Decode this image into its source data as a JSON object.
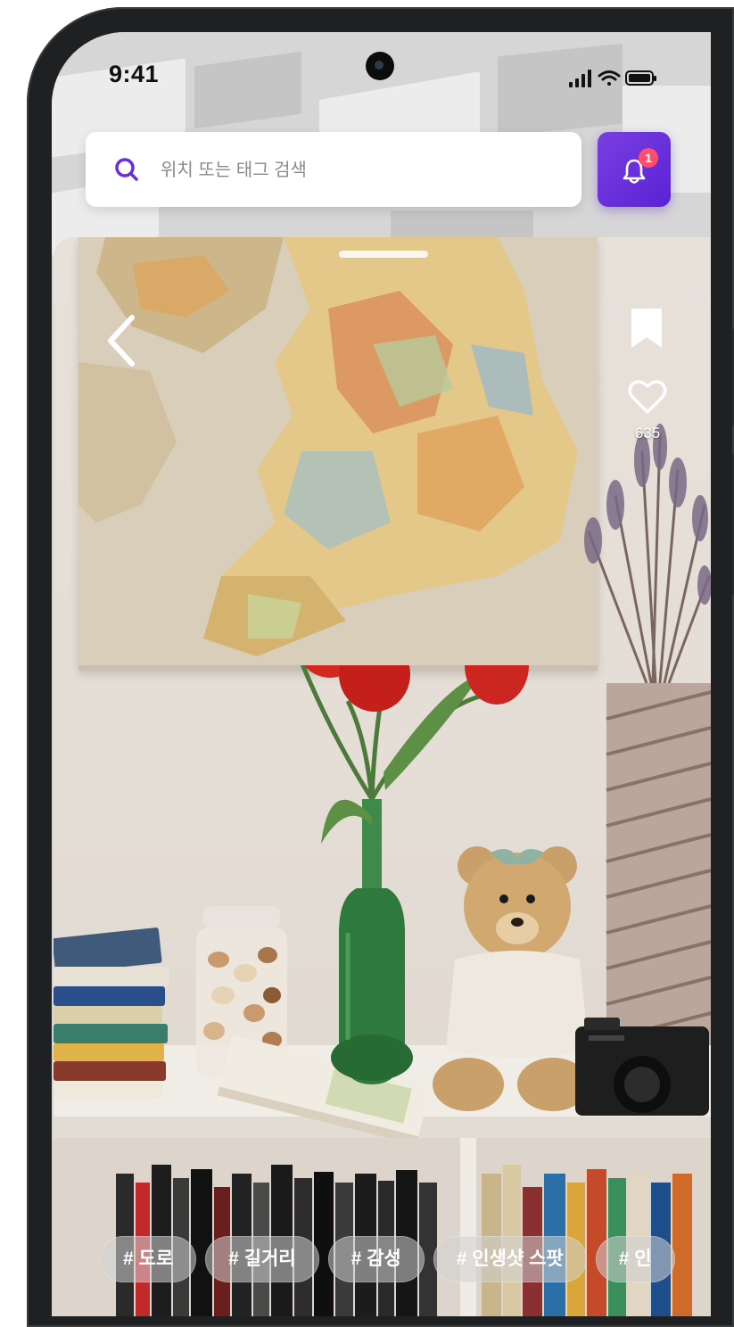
{
  "status_bar": {
    "time": "9:41"
  },
  "search": {
    "placeholder": "위치 또는 태그 검색",
    "value": ""
  },
  "notifications": {
    "badge_count": "1"
  },
  "post": {
    "like_count": "635"
  },
  "tags": [
    "# 도로",
    "# 길거리",
    "# 감성",
    "# 인생샷 스팟",
    "# 인"
  ],
  "colors": {
    "accent": "#6a2fdc",
    "badge": "#ff4d6a"
  },
  "icons": [
    "search-icon",
    "bell-icon",
    "back-chevron-icon",
    "bookmark-icon",
    "heart-icon",
    "signal-icon",
    "wifi-icon",
    "battery-icon"
  ]
}
